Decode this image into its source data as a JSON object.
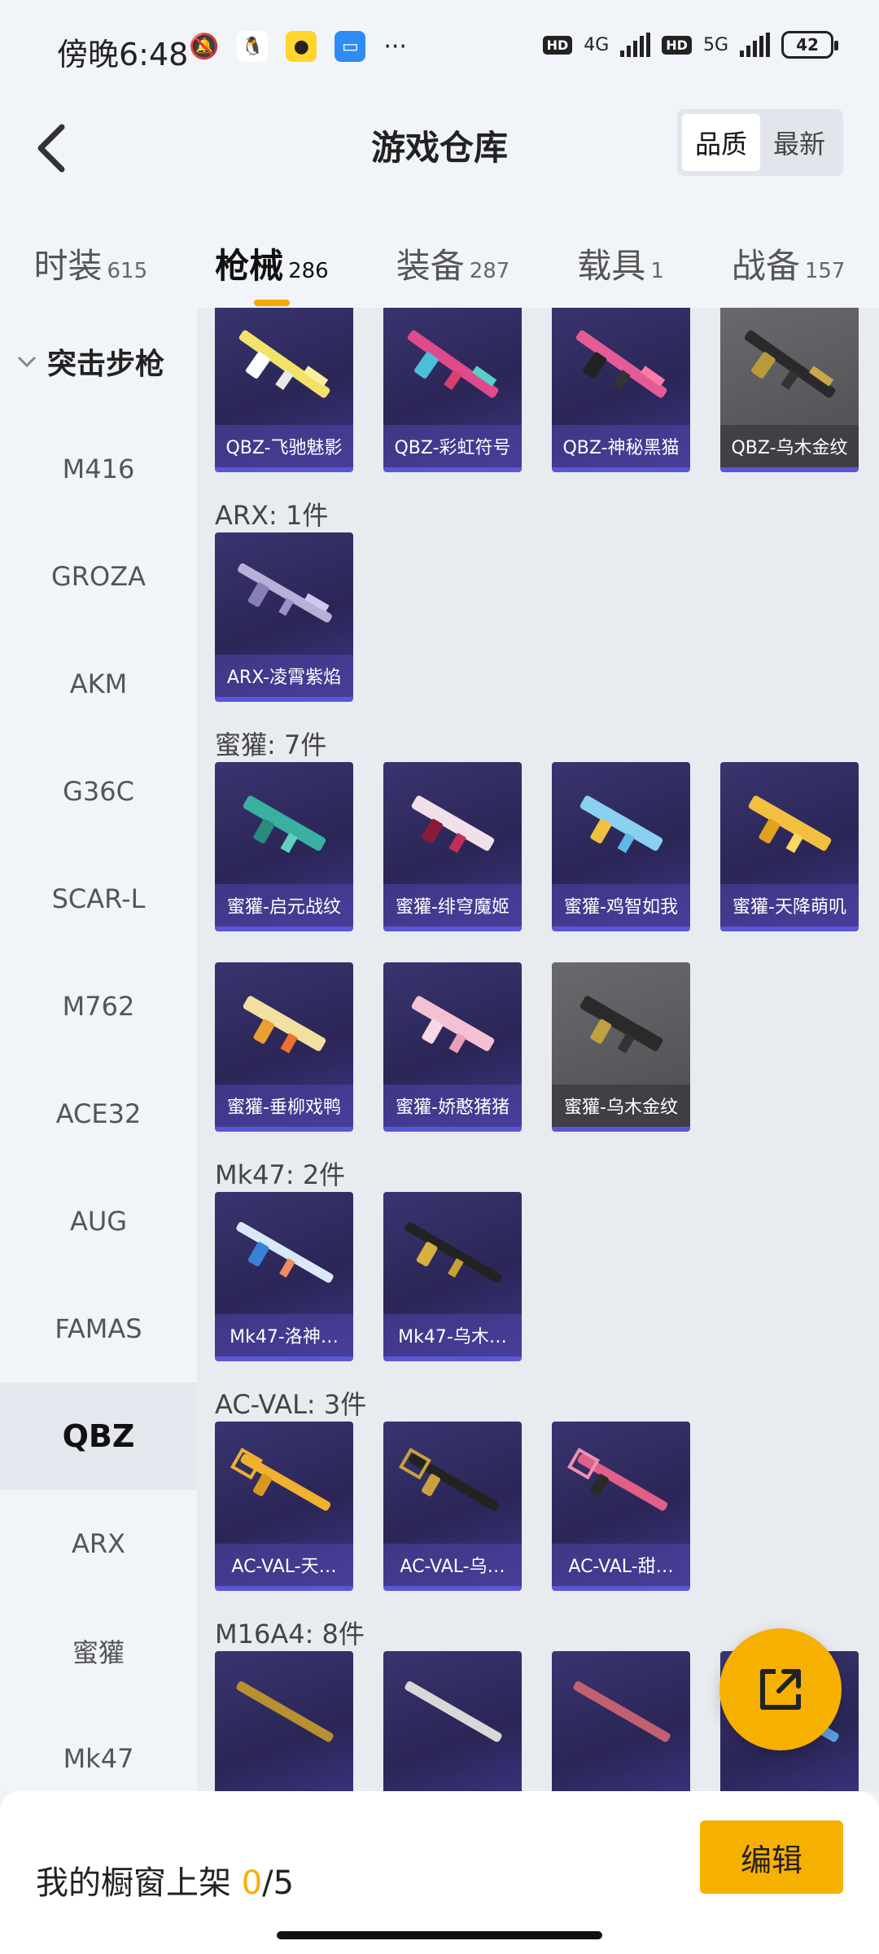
{
  "status": {
    "time": "傍晚6:48",
    "network1": "4G",
    "network2": "5G",
    "battery": "42"
  },
  "header": {
    "title": "游戏仓库",
    "sort_quality": "品质",
    "sort_latest": "最新"
  },
  "tabs": [
    {
      "label": "时装",
      "count": "615"
    },
    {
      "label": "枪械",
      "count": "286"
    },
    {
      "label": "装备",
      "count": "287"
    },
    {
      "label": "载具",
      "count": "1"
    },
    {
      "label": "战备",
      "count": "157"
    }
  ],
  "sidebar": {
    "category": "突击步枪",
    "items": [
      "M416",
      "GROZA",
      "AKM",
      "G36C",
      "SCAR-L",
      "M762",
      "ACE32",
      "AUG",
      "FAMAS",
      "QBZ",
      "ARX",
      "蜜獾",
      "Mk47"
    ]
  },
  "groups": {
    "qbz_items": [
      "QBZ-飞驰魅影",
      "QBZ-彩虹符号",
      "QBZ-神秘黑猫",
      "QBZ-乌木金纹"
    ],
    "arx_title": "ARX: 1件",
    "arx_items": [
      "ARX-凌霄紫焰"
    ],
    "honey_title": "蜜獾: 7件",
    "honey_items": [
      "蜜獾-启元战纹",
      "蜜獾-绯穹魔姬",
      "蜜獾-鸡智如我",
      "蜜獾-天降萌叽",
      "蜜獾-垂柳戏鸭",
      "蜜獾-娇憨猪猪",
      "蜜獾-乌木金纹"
    ],
    "mk47_title": "Mk47: 2件",
    "mk47_items": [
      "Mk47-洛神…",
      "Mk47-乌木…"
    ],
    "acval_title": "AC-VAL: 3件",
    "acval_items": [
      "AC-VAL-天…",
      "AC-VAL-乌…",
      "AC-VAL-甜…"
    ],
    "m16_title": "M16A4: 8件"
  },
  "bottom": {
    "label": "我的橱窗上架",
    "current": "0",
    "total": "/5",
    "edit": "编辑"
  },
  "colors": {
    "accent": "#f6b000",
    "card_purple": "#2b2656",
    "card_border": "#5a57d6"
  }
}
